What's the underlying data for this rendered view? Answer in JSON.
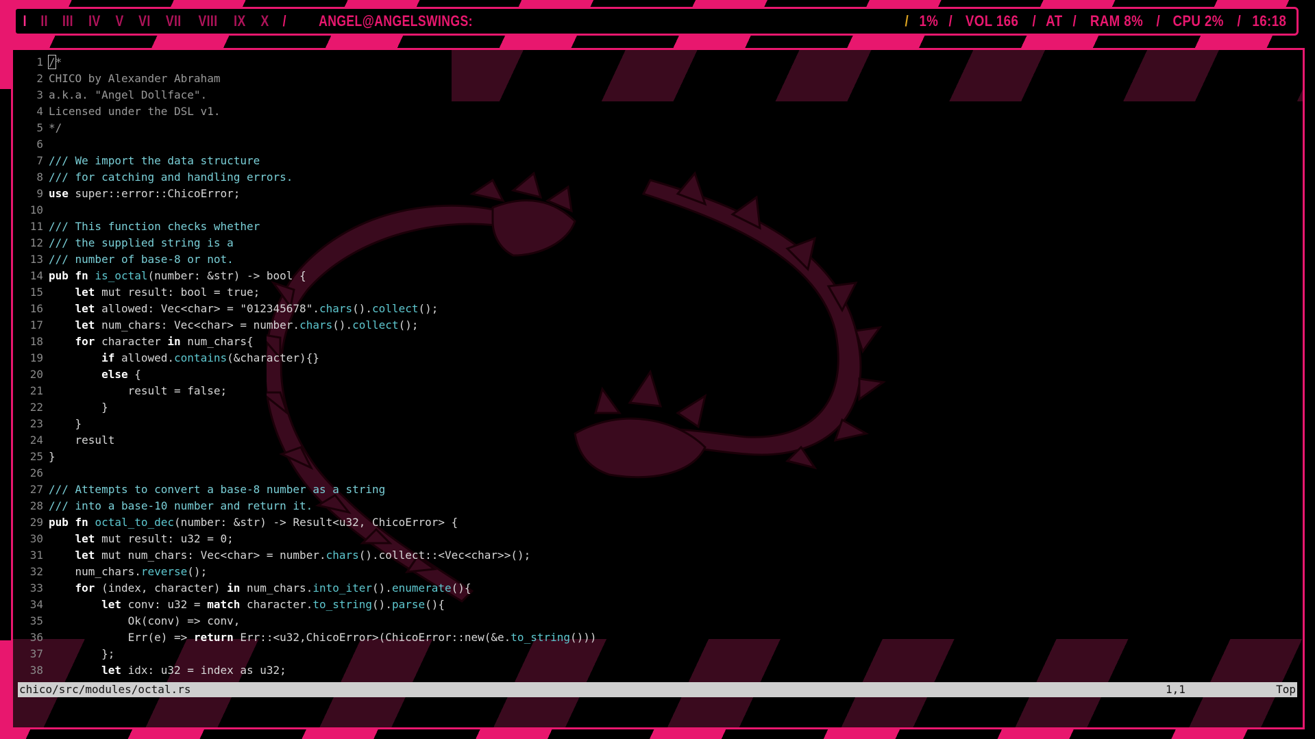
{
  "topbar": {
    "workspaces": [
      "I",
      "II",
      "III",
      "IV",
      "V",
      "VI",
      "VII",
      "VIII",
      "IX",
      "X"
    ],
    "separator": "/",
    "host": "ANGEL@ANGELSWINGS:",
    "status": [
      "1%",
      "VOL 166",
      "AT",
      "RAM  8%",
      "CPU  2%",
      "16:18"
    ]
  },
  "editor": {
    "lines": [
      {
        "n": "1",
        "t": "/*"
      },
      {
        "n": "2",
        "t": "CHICO by Alexander Abraham"
      },
      {
        "n": "3",
        "t": "a.k.a. \"Angel Dollface\"."
      },
      {
        "n": "4",
        "t": "Licensed under the DSL v1."
      },
      {
        "n": "5",
        "t": "*/"
      },
      {
        "n": "6",
        "t": ""
      },
      {
        "n": "7",
        "t": "/// We import the data structure"
      },
      {
        "n": "8",
        "t": "/// for catching and handling errors."
      },
      {
        "n": "9",
        "t": "use super::error::ChicoError;"
      },
      {
        "n": "10",
        "t": ""
      },
      {
        "n": "11",
        "t": "/// This function checks whether"
      },
      {
        "n": "12",
        "t": "/// the supplied string is a"
      },
      {
        "n": "13",
        "t": "/// number of base-8 or not."
      },
      {
        "n": "14",
        "t": "pub fn is_octal(number: &str) -> bool {"
      },
      {
        "n": "15",
        "t": "    let mut result: bool = true;"
      },
      {
        "n": "16",
        "t": "    let allowed: Vec<char> = \"012345678\".chars().collect();"
      },
      {
        "n": "17",
        "t": "    let num_chars: Vec<char> = number.chars().collect();"
      },
      {
        "n": "18",
        "t": "    for character in num_chars{"
      },
      {
        "n": "19",
        "t": "        if allowed.contains(&character){}"
      },
      {
        "n": "20",
        "t": "        else {"
      },
      {
        "n": "21",
        "t": "            result = false;"
      },
      {
        "n": "22",
        "t": "        }"
      },
      {
        "n": "23",
        "t": "    }"
      },
      {
        "n": "24",
        "t": "    result"
      },
      {
        "n": "25",
        "t": "}"
      },
      {
        "n": "26",
        "t": ""
      },
      {
        "n": "27",
        "t": "/// Attempts to convert a base-8 number as a string"
      },
      {
        "n": "28",
        "t": "/// into a base-10 number and return it."
      },
      {
        "n": "29",
        "t": "pub fn octal_to_dec(number: &str) -> Result<u32, ChicoError> {"
      },
      {
        "n": "30",
        "t": "    let mut result: u32 = 0;"
      },
      {
        "n": "31",
        "t": "    let mut num_chars: Vec<char> = number.chars().collect::<Vec<char>>();"
      },
      {
        "n": "32",
        "t": "    num_chars.reverse();"
      },
      {
        "n": "33",
        "t": "    for (index, character) in num_chars.into_iter().enumerate(){"
      },
      {
        "n": "34",
        "t": "        let conv: u32 = match character.to_string().parse(){"
      },
      {
        "n": "35",
        "t": "            Ok(conv) => conv,"
      },
      {
        "n": "36",
        "t": "            Err(e) => return Err::<u32,ChicoError>(ChicoError::new(&e.to_string()))"
      },
      {
        "n": "37",
        "t": "        };"
      },
      {
        "n": "38",
        "t": "        let idx: u32 = index as u32;"
      }
    ]
  },
  "statusline": {
    "file": "chico/src/modules/octal.rs",
    "position": "1,1",
    "scroll": "Top"
  },
  "colors": {
    "accent": "#e8176e",
    "dragon": "#3a0a1e"
  }
}
